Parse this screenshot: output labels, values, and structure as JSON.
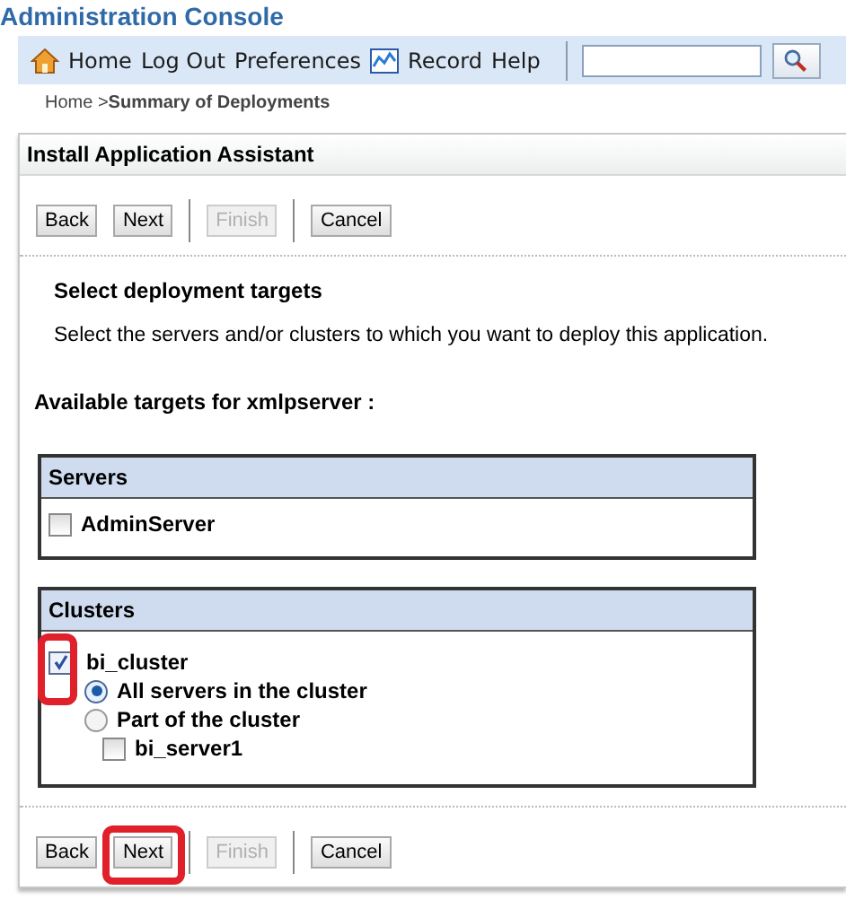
{
  "title": "Administration Console",
  "nav": [
    {
      "label": "Home",
      "kind": "icon_link"
    },
    {
      "label": "Log Out",
      "kind": "link"
    },
    {
      "label": "Preferences",
      "kind": "link"
    },
    {
      "label": "Record",
      "kind": "icon_link"
    },
    {
      "label": "Help",
      "kind": "link"
    }
  ],
  "breadcrumb": [
    {
      "label": "Home >",
      "current": false
    },
    {
      "label": "Summary of Deployments",
      "current": true
    }
  ],
  "panel_title": "Install Application Assistant",
  "top_toolbar": [
    [
      {
        "label": "Back",
        "disabled": false,
        "highlighted": false
      },
      {
        "label": "Next",
        "disabled": false,
        "highlighted": false
      }
    ],
    [
      {
        "label": "Finish",
        "disabled": true,
        "highlighted": false
      }
    ],
    [
      {
        "label": "Cancel",
        "disabled": false,
        "highlighted": false
      }
    ]
  ],
  "section_title": "Select deployment targets",
  "description": "Select the servers and/or clusters to which you want to deploy this application.",
  "targets_label": "Available targets for xmlpserver :",
  "servers": {
    "heading": "Servers",
    "items": [
      {
        "label": "AdminServer",
        "checked": false
      }
    ]
  },
  "clusters": {
    "heading": "Clusters",
    "items": [
      {
        "label": "bi_cluster",
        "checked": true,
        "highlighted": true,
        "options": [
          {
            "label": "All servers in the cluster",
            "selected": true
          },
          {
            "label": "Part of the cluster",
            "selected": false,
            "children": [
              {
                "label": "bi_server1",
                "checked": false
              }
            ]
          }
        ]
      }
    ]
  },
  "bottom_toolbar": [
    [
      {
        "label": "Back",
        "disabled": false,
        "highlighted": false
      },
      {
        "label": "Next",
        "disabled": false,
        "highlighted": true
      }
    ],
    [
      {
        "label": "Finish",
        "disabled": true,
        "highlighted": false
      }
    ],
    [
      {
        "label": "Cancel",
        "disabled": false,
        "highlighted": false
      }
    ]
  ]
}
